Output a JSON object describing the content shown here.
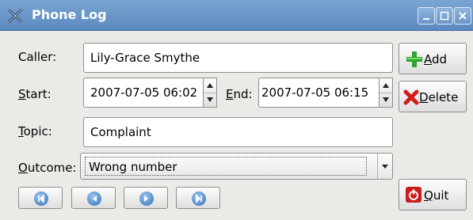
{
  "window": {
    "title": "Phone Log"
  },
  "form": {
    "caller_label": "Caller:",
    "caller_value": "Lily-Grace Smythe",
    "start_label_u": "S",
    "start_label_rest": "tart:",
    "start_value": "2007-07-05 06:02",
    "end_label_u": "E",
    "end_label_rest": "nd:",
    "end_value": "2007-07-05 06:15",
    "topic_label_u": "T",
    "topic_label_rest": "opic:",
    "topic_value": "Complaint",
    "outcome_label_u": "O",
    "outcome_label_rest": "utcome:",
    "outcome_value": "Wrong number"
  },
  "buttons": {
    "add_u": "A",
    "add_rest": "dd",
    "delete_u": "D",
    "delete_rest": "elete",
    "quit_u": "Q",
    "quit_rest": "uit"
  },
  "icons": {
    "app": "x-icon",
    "minimize": "minimize-icon",
    "maximize": "maximize-icon",
    "close": "close-icon",
    "add": "plus-icon",
    "delete": "red-x-icon",
    "quit": "power-icon",
    "nav": [
      "first-icon",
      "previous-icon",
      "next-icon",
      "last-icon"
    ]
  },
  "colors": {
    "titlebar": "#6a97c9",
    "accent": "#2f6fb7"
  }
}
